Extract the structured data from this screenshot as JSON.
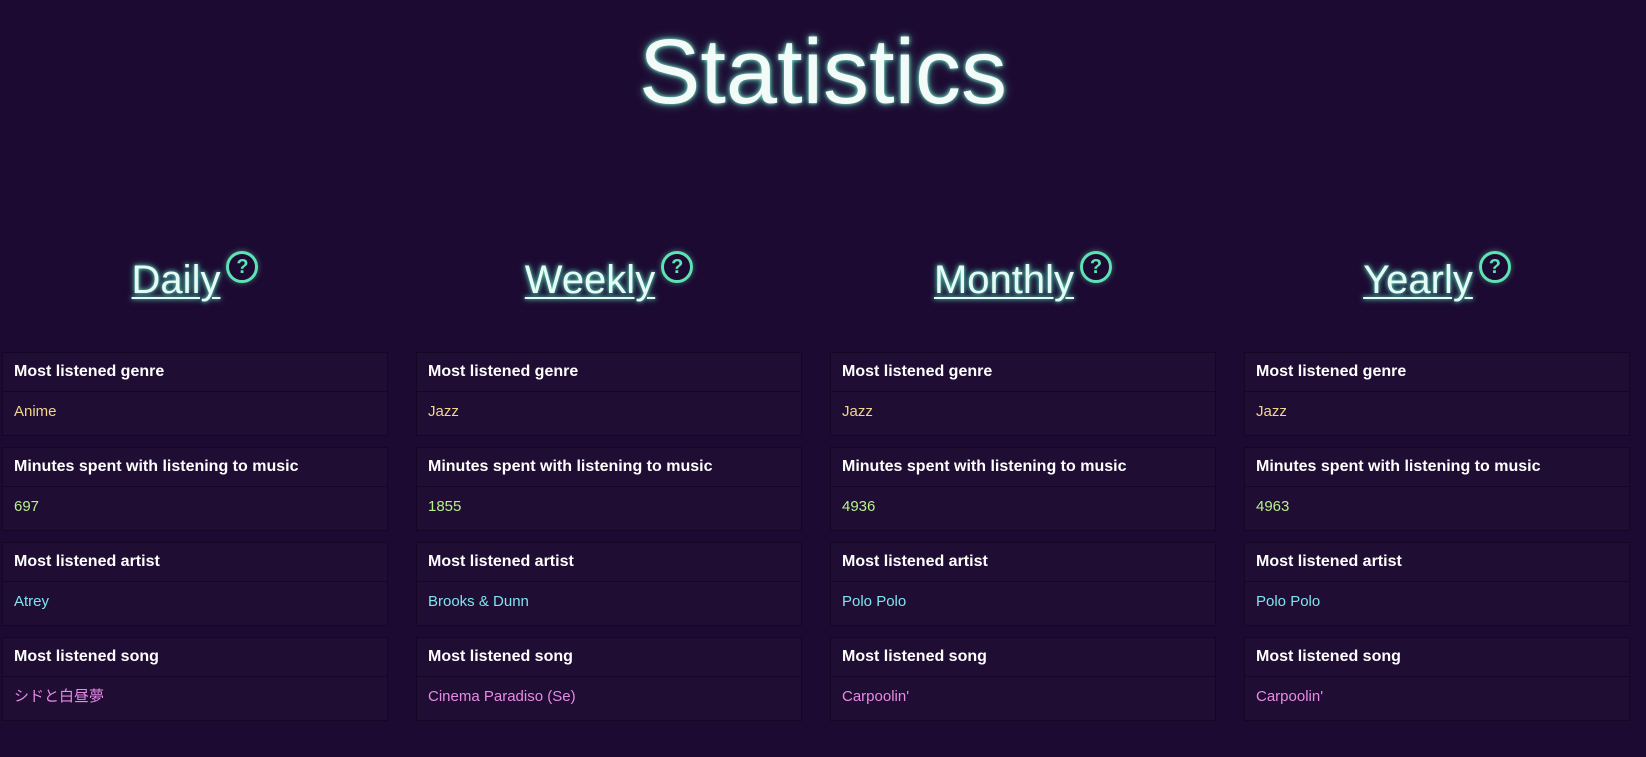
{
  "page": {
    "title": "Statistics"
  },
  "colors": {
    "background": "#1d0a32",
    "genre_value": "#f1d58a",
    "minutes_value": "#b8f08a",
    "artist_value": "#7fe3ee",
    "song_value": "#e88ae6",
    "help_icon": "#5ee3b4"
  },
  "periods": [
    {
      "heading": "Daily",
      "help_icon": "question-circle-icon",
      "stats": [
        {
          "label": "Most listened genre",
          "value": "Anime"
        },
        {
          "label": "Minutes spent with listening to music",
          "value": "697"
        },
        {
          "label": "Most listened artist",
          "value": "Atrey"
        },
        {
          "label": "Most listened song",
          "value": "シドと白昼夢"
        }
      ]
    },
    {
      "heading": "Weekly",
      "help_icon": "question-circle-icon",
      "stats": [
        {
          "label": "Most listened genre",
          "value": "Jazz"
        },
        {
          "label": "Minutes spent with listening to music",
          "value": "1855"
        },
        {
          "label": "Most listened artist",
          "value": "Brooks & Dunn"
        },
        {
          "label": "Most listened song",
          "value": "Cinema Paradiso (Se)"
        }
      ]
    },
    {
      "heading": "Monthly",
      "help_icon": "question-circle-icon",
      "stats": [
        {
          "label": "Most listened genre",
          "value": "Jazz"
        },
        {
          "label": "Minutes spent with listening to music",
          "value": "4936"
        },
        {
          "label": "Most listened artist",
          "value": "Polo Polo"
        },
        {
          "label": "Most listened song",
          "value": "Carpoolin'"
        }
      ]
    },
    {
      "heading": "Yearly",
      "help_icon": "question-circle-icon",
      "stats": [
        {
          "label": "Most listened genre",
          "value": "Jazz"
        },
        {
          "label": "Minutes spent with listening to music",
          "value": "4963"
        },
        {
          "label": "Most listened artist",
          "value": "Polo Polo"
        },
        {
          "label": "Most listened song",
          "value": "Carpoolin'"
        }
      ]
    }
  ]
}
